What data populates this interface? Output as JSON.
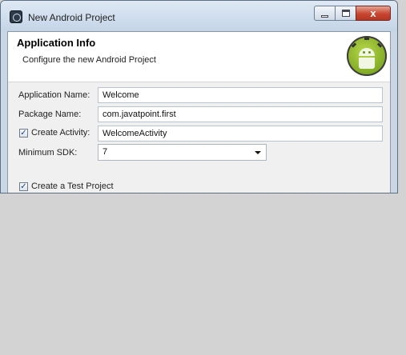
{
  "window": {
    "title": "New Android Project",
    "icon": "eclipse-icon",
    "close_glyph": "x"
  },
  "banner": {
    "title": "Application Info",
    "subtitle": "Configure the new Android Project",
    "logo": "android-logo"
  },
  "form": {
    "application_name": {
      "label": "Application Name:",
      "value": "Welcome"
    },
    "package_name": {
      "label": "Package Name:",
      "value": "com.javatpoint.first"
    },
    "create_activity": {
      "label": "Create Activity:",
      "checked": true,
      "value": "WelcomeActivity"
    },
    "minimum_sdk": {
      "label": "Minimum SDK:",
      "value": "7"
    },
    "create_test_project": {
      "label": "Create a Test Project",
      "checked": true
    }
  },
  "colors": {
    "background_gray": "#d3d3d3",
    "window_frame": "#c8d6e6",
    "close_button": "#c74630",
    "android_green": "#7ea824"
  }
}
